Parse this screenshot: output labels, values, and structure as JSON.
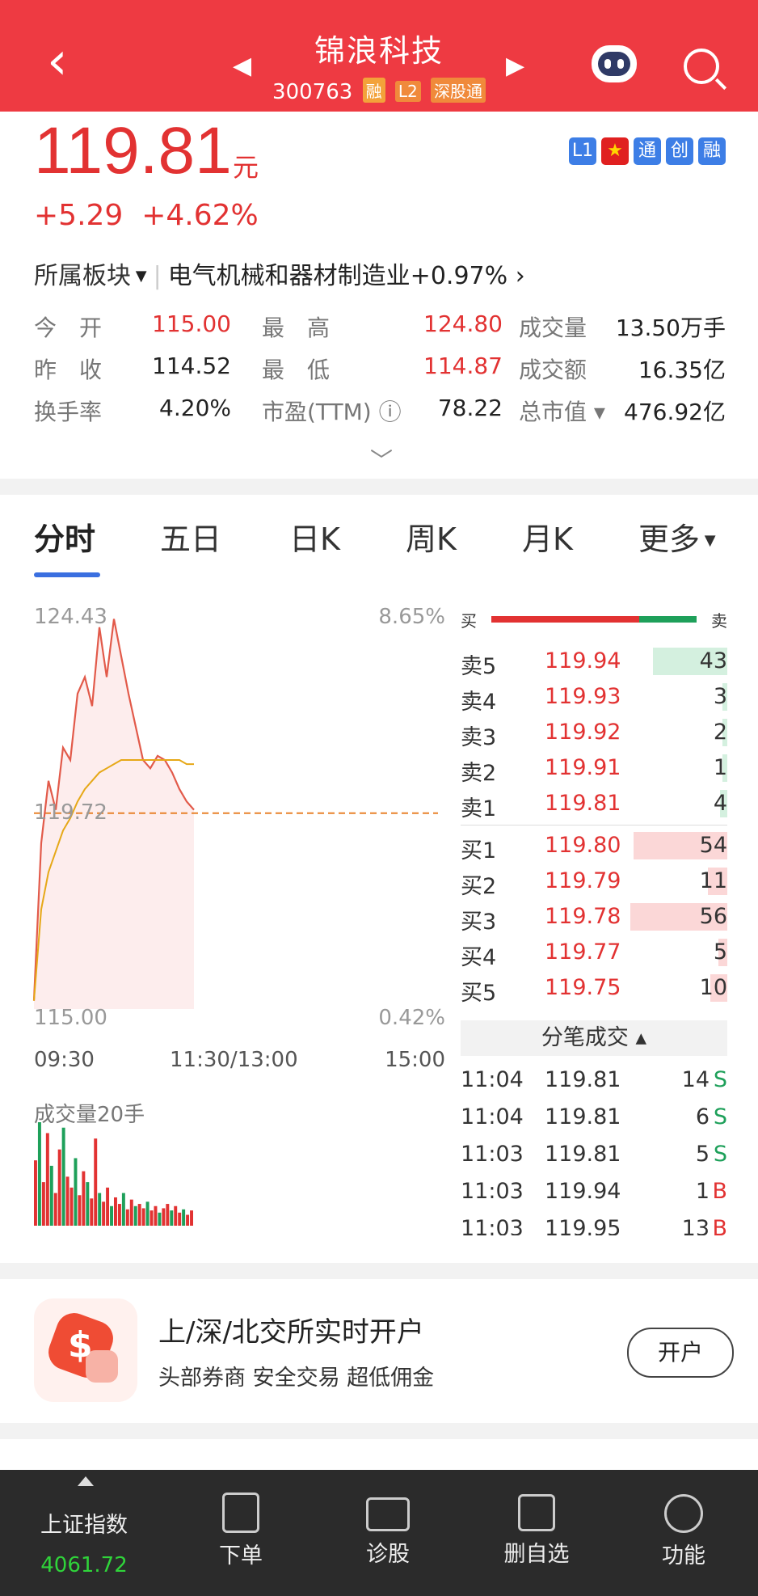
{
  "header": {
    "title": "锦浪科技",
    "code": "300763",
    "tags": [
      "融",
      "L2",
      "深股通"
    ]
  },
  "quote": {
    "price": "119.81",
    "unit": "元",
    "change": "+5.29",
    "change_pct": "+4.62%",
    "badges": [
      "L1",
      "★",
      "通",
      "创",
      "融"
    ]
  },
  "sector": {
    "label": "所属板块",
    "name": "电气机械和器材制造业+0.97%",
    "arrow": "›"
  },
  "stats": [
    [
      {
        "label": "今　开",
        "value": "115.00",
        "red": true
      },
      {
        "label": "最　高",
        "value": "124.80",
        "red": true
      },
      {
        "label": "成交量",
        "value": "13.50万手",
        "red": false
      }
    ],
    [
      {
        "label": "昨　收",
        "value": "114.52",
        "red": false
      },
      {
        "label": "最　低",
        "value": "114.87",
        "red": true
      },
      {
        "label": "成交额",
        "value": "16.35亿",
        "red": false
      }
    ],
    [
      {
        "label": "换手率",
        "value": "4.20%",
        "red": false
      },
      {
        "label": "市盈(TTM) ⓘ",
        "value": "78.22",
        "red": false
      },
      {
        "label": "总市值 ▾",
        "value": "476.92亿",
        "red": false
      }
    ]
  ],
  "tabs": [
    "分时",
    "五日",
    "日K",
    "周K",
    "月K",
    "更多"
  ],
  "chart": {
    "y_top": "124.43",
    "y_top_pct": "8.65%",
    "y_mid": "119.72",
    "y_bottom": "115.00",
    "y_bottom_pct": "0.42%",
    "x_labels": [
      "09:30",
      "11:30/13:00",
      "15:00"
    ],
    "volume_label": "成交量20手"
  },
  "chart_data": {
    "type": "line",
    "x_range": [
      "09:30",
      "15:00"
    ],
    "ylim": [
      115.0,
      124.43
    ],
    "reference_price": 119.72,
    "series": [
      {
        "name": "price",
        "values": [
          115.2,
          119.0,
          120.5,
          119.8,
          121.3,
          121.0,
          122.6,
          123.0,
          122.3,
          124.2,
          123.0,
          124.4,
          123.5,
          122.6,
          121.8,
          121.0,
          120.8,
          121.1,
          121.0,
          120.7,
          120.3,
          120.0,
          119.8
        ]
      },
      {
        "name": "avg",
        "values": [
          115.2,
          117.4,
          118.3,
          118.8,
          119.3,
          119.6,
          120.0,
          120.3,
          120.5,
          120.7,
          120.8,
          120.9,
          121.0,
          121.0,
          121.0,
          121.0,
          121.0,
          121.0,
          121.0,
          121.0,
          121.0,
          120.9,
          120.9
        ]
      }
    ],
    "volume": [
      60,
      95,
      40,
      85,
      55,
      30,
      70,
      90,
      45,
      35,
      62,
      28,
      50,
      40,
      25,
      80,
      30,
      22,
      35,
      18,
      26,
      20,
      30,
      15,
      24,
      18,
      20,
      16,
      22,
      14,
      18,
      12,
      16,
      20,
      14,
      18,
      12,
      15,
      10,
      14
    ]
  },
  "orderbook": {
    "sell": [
      {
        "label": "卖5",
        "price": "119.94",
        "vol": "43"
      },
      {
        "label": "卖4",
        "price": "119.93",
        "vol": "3"
      },
      {
        "label": "卖3",
        "price": "119.92",
        "vol": "2"
      },
      {
        "label": "卖2",
        "price": "119.91",
        "vol": "1"
      },
      {
        "label": "卖1",
        "price": "119.81",
        "vol": "4"
      }
    ],
    "buy": [
      {
        "label": "买1",
        "price": "119.80",
        "vol": "54"
      },
      {
        "label": "买2",
        "price": "119.79",
        "vol": "11"
      },
      {
        "label": "买3",
        "price": "119.78",
        "vol": "56"
      },
      {
        "label": "买4",
        "price": "119.77",
        "vol": "5"
      },
      {
        "label": "买5",
        "price": "119.75",
        "vol": "10"
      }
    ],
    "ratio_buy_label": "买",
    "ratio_sell_label": "卖",
    "buy_ratio": 0.72
  },
  "ticks_header": "分笔成交 ▴",
  "ticks": [
    {
      "time": "11:04",
      "price": "119.81",
      "vol": "14",
      "side": "S"
    },
    {
      "time": "11:04",
      "price": "119.81",
      "vol": "6",
      "side": "S"
    },
    {
      "time": "11:03",
      "price": "119.81",
      "vol": "5",
      "side": "S"
    },
    {
      "time": "11:03",
      "price": "119.94",
      "vol": "1",
      "side": "B"
    },
    {
      "time": "11:03",
      "price": "119.95",
      "vol": "13",
      "side": "B"
    }
  ],
  "ad": {
    "title": "上/深/北交所实时开户",
    "subtitle": "头部券商  安全交易  超低佣金",
    "button": "开户"
  },
  "bottom": {
    "index_name": "上证指数",
    "index_value": "4061.72",
    "items": [
      "下单",
      "诊股",
      "删自选",
      "功能"
    ]
  },
  "colors": {
    "red": "#e23232",
    "green": "#1ea05a",
    "header": "#ee3a42",
    "avg": "#e6a817"
  }
}
